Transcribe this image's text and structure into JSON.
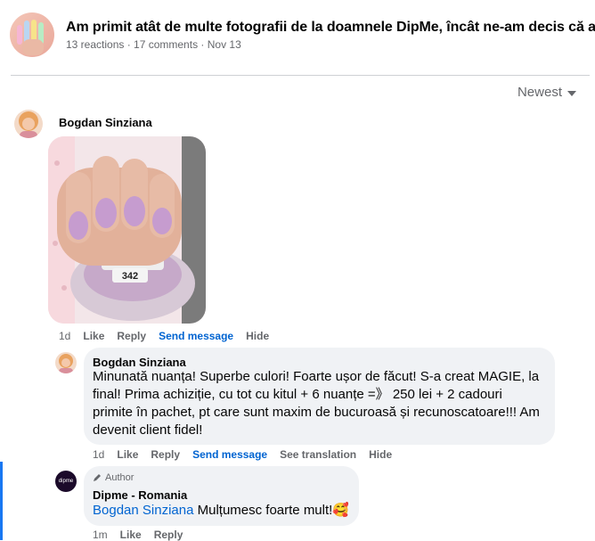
{
  "post": {
    "title": "Am primit atât de multe fotografii de la doamnele DipMe, încât ne-am decis că a",
    "meta": "13 reactions · 17 comments · Nov 13"
  },
  "sort": {
    "label": "Newest"
  },
  "comment1": {
    "author": "Bogdan Sinziana",
    "photo_label": "342",
    "actions": {
      "time": "1d",
      "like": "Like",
      "reply": "Reply",
      "send": "Send message",
      "hide": "Hide"
    }
  },
  "reply1": {
    "author": "Bogdan Sinziana",
    "text": "Minunată nuanța! Superbe culori! Foarte ușor de făcut! S-a creat MAGIE, la final! Prima achiziție, cu tot cu kitul + 6 nuanțe =》 250 lei + 2 cadouri primite în pachet, pt care sunt maxim de bucuroasă și recunoscatoare!!! Am devenit client fidel!",
    "actions": {
      "time": "1d",
      "like": "Like",
      "reply": "Reply",
      "send": "Send message",
      "translate": "See translation",
      "hide": "Hide"
    }
  },
  "reply2": {
    "badge": "Author",
    "author": "Dipme - Romania",
    "avatar_text": "dipme",
    "mention": "Bogdan Sinziana",
    "text": " Mulțumesc foarte mult!🥰",
    "actions": {
      "time": "1m",
      "like": "Like",
      "reply": "Reply"
    }
  },
  "colors": {
    "link": "#0064d1",
    "bubble": "#f0f2f5",
    "thread": "#1877f2"
  }
}
